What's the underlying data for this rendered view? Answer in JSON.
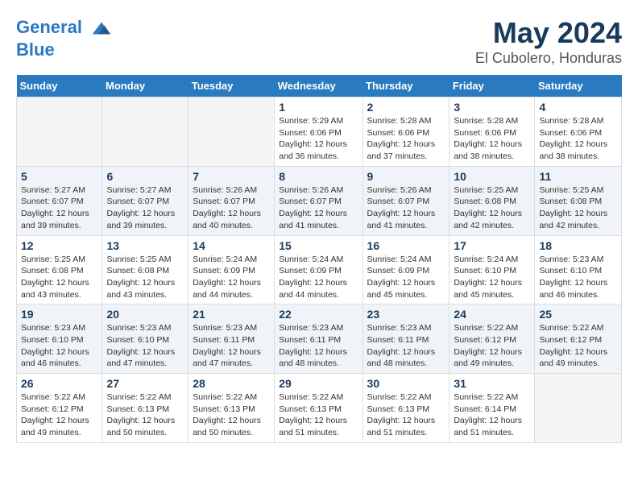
{
  "header": {
    "logo_line1": "General",
    "logo_line2": "Blue",
    "title": "May 2024",
    "subtitle": "El Cubolero, Honduras"
  },
  "days_of_week": [
    "Sunday",
    "Monday",
    "Tuesday",
    "Wednesday",
    "Thursday",
    "Friday",
    "Saturday"
  ],
  "weeks": [
    [
      {
        "day": "",
        "info": ""
      },
      {
        "day": "",
        "info": ""
      },
      {
        "day": "",
        "info": ""
      },
      {
        "day": "1",
        "info": "Sunrise: 5:29 AM\nSunset: 6:06 PM\nDaylight: 12 hours and 36 minutes."
      },
      {
        "day": "2",
        "info": "Sunrise: 5:28 AM\nSunset: 6:06 PM\nDaylight: 12 hours and 37 minutes."
      },
      {
        "day": "3",
        "info": "Sunrise: 5:28 AM\nSunset: 6:06 PM\nDaylight: 12 hours and 38 minutes."
      },
      {
        "day": "4",
        "info": "Sunrise: 5:28 AM\nSunset: 6:06 PM\nDaylight: 12 hours and 38 minutes."
      }
    ],
    [
      {
        "day": "5",
        "info": "Sunrise: 5:27 AM\nSunset: 6:07 PM\nDaylight: 12 hours and 39 minutes."
      },
      {
        "day": "6",
        "info": "Sunrise: 5:27 AM\nSunset: 6:07 PM\nDaylight: 12 hours and 39 minutes."
      },
      {
        "day": "7",
        "info": "Sunrise: 5:26 AM\nSunset: 6:07 PM\nDaylight: 12 hours and 40 minutes."
      },
      {
        "day": "8",
        "info": "Sunrise: 5:26 AM\nSunset: 6:07 PM\nDaylight: 12 hours and 41 minutes."
      },
      {
        "day": "9",
        "info": "Sunrise: 5:26 AM\nSunset: 6:07 PM\nDaylight: 12 hours and 41 minutes."
      },
      {
        "day": "10",
        "info": "Sunrise: 5:25 AM\nSunset: 6:08 PM\nDaylight: 12 hours and 42 minutes."
      },
      {
        "day": "11",
        "info": "Sunrise: 5:25 AM\nSunset: 6:08 PM\nDaylight: 12 hours and 42 minutes."
      }
    ],
    [
      {
        "day": "12",
        "info": "Sunrise: 5:25 AM\nSunset: 6:08 PM\nDaylight: 12 hours and 43 minutes."
      },
      {
        "day": "13",
        "info": "Sunrise: 5:25 AM\nSunset: 6:08 PM\nDaylight: 12 hours and 43 minutes."
      },
      {
        "day": "14",
        "info": "Sunrise: 5:24 AM\nSunset: 6:09 PM\nDaylight: 12 hours and 44 minutes."
      },
      {
        "day": "15",
        "info": "Sunrise: 5:24 AM\nSunset: 6:09 PM\nDaylight: 12 hours and 44 minutes."
      },
      {
        "day": "16",
        "info": "Sunrise: 5:24 AM\nSunset: 6:09 PM\nDaylight: 12 hours and 45 minutes."
      },
      {
        "day": "17",
        "info": "Sunrise: 5:24 AM\nSunset: 6:10 PM\nDaylight: 12 hours and 45 minutes."
      },
      {
        "day": "18",
        "info": "Sunrise: 5:23 AM\nSunset: 6:10 PM\nDaylight: 12 hours and 46 minutes."
      }
    ],
    [
      {
        "day": "19",
        "info": "Sunrise: 5:23 AM\nSunset: 6:10 PM\nDaylight: 12 hours and 46 minutes."
      },
      {
        "day": "20",
        "info": "Sunrise: 5:23 AM\nSunset: 6:10 PM\nDaylight: 12 hours and 47 minutes."
      },
      {
        "day": "21",
        "info": "Sunrise: 5:23 AM\nSunset: 6:11 PM\nDaylight: 12 hours and 47 minutes."
      },
      {
        "day": "22",
        "info": "Sunrise: 5:23 AM\nSunset: 6:11 PM\nDaylight: 12 hours and 48 minutes."
      },
      {
        "day": "23",
        "info": "Sunrise: 5:23 AM\nSunset: 6:11 PM\nDaylight: 12 hours and 48 minutes."
      },
      {
        "day": "24",
        "info": "Sunrise: 5:22 AM\nSunset: 6:12 PM\nDaylight: 12 hours and 49 minutes."
      },
      {
        "day": "25",
        "info": "Sunrise: 5:22 AM\nSunset: 6:12 PM\nDaylight: 12 hours and 49 minutes."
      }
    ],
    [
      {
        "day": "26",
        "info": "Sunrise: 5:22 AM\nSunset: 6:12 PM\nDaylight: 12 hours and 49 minutes."
      },
      {
        "day": "27",
        "info": "Sunrise: 5:22 AM\nSunset: 6:13 PM\nDaylight: 12 hours and 50 minutes."
      },
      {
        "day": "28",
        "info": "Sunrise: 5:22 AM\nSunset: 6:13 PM\nDaylight: 12 hours and 50 minutes."
      },
      {
        "day": "29",
        "info": "Sunrise: 5:22 AM\nSunset: 6:13 PM\nDaylight: 12 hours and 51 minutes."
      },
      {
        "day": "30",
        "info": "Sunrise: 5:22 AM\nSunset: 6:13 PM\nDaylight: 12 hours and 51 minutes."
      },
      {
        "day": "31",
        "info": "Sunrise: 5:22 AM\nSunset: 6:14 PM\nDaylight: 12 hours and 51 minutes."
      },
      {
        "day": "",
        "info": ""
      }
    ]
  ]
}
